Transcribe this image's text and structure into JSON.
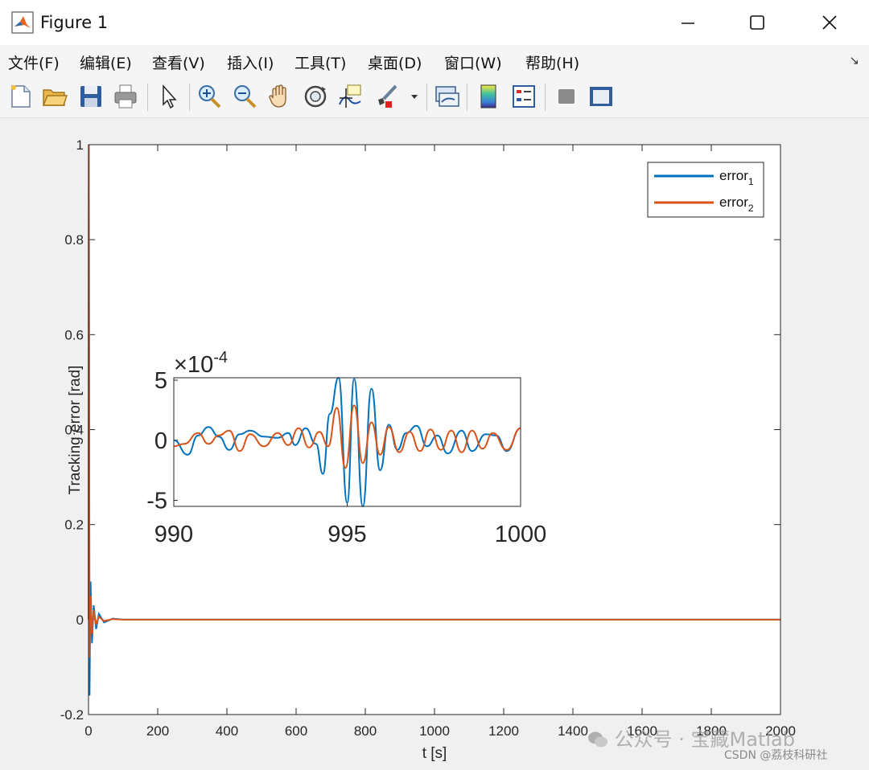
{
  "window": {
    "title": "Figure 1",
    "minimize_glyph": "—",
    "icons": [
      "matlab-logo-icon",
      "minimize-icon",
      "maximize-icon",
      "close-icon"
    ]
  },
  "menu": {
    "items": [
      "文件(F)",
      "编辑(E)",
      "查看(V)",
      "插入(I)",
      "工具(T)",
      "桌面(D)",
      "窗口(W)",
      "帮助(H)"
    ],
    "overflow_glyph": "↘"
  },
  "toolbar": {
    "icons": [
      "new-figure-icon",
      "open-file-icon",
      "save-icon",
      "print-icon",
      "select-arrow-icon",
      "zoom-in-icon",
      "zoom-out-icon",
      "pan-hand-icon",
      "rotate-3d-icon",
      "data-cursor-icon",
      "brush-icon",
      "link-plot-icon",
      "colorbar-icon",
      "legend-icon",
      "hide-plot-tools-icon",
      "show-plot-tools-icon"
    ]
  },
  "colors": {
    "error1": "#0072bd",
    "error2": "#d95319",
    "axes_bg": "#ffffff",
    "figure_bg": "#f0f0f0"
  },
  "chart_data": [
    {
      "type": "line",
      "xlabel": "t [s]",
      "ylabel": "Tracking error [rad]",
      "xlim": [
        0,
        2000
      ],
      "ylim": [
        -0.2,
        1
      ],
      "xticks": [
        "0",
        "200",
        "400",
        "600",
        "800",
        "1000",
        "1200",
        "1400",
        "1600",
        "1800",
        "2000"
      ],
      "yticks": [
        "-0.2",
        "0",
        "0.2",
        "0.4",
        "0.6",
        "0.8",
        "1"
      ],
      "legend": {
        "position": "top-right",
        "entries": [
          {
            "name": "error",
            "sub": "1"
          },
          {
            "name": "error",
            "sub": "2"
          }
        ]
      },
      "series": [
        {
          "name": "error1",
          "points": [
            [
              0,
              0
            ],
            [
              1,
              1
            ],
            [
              3,
              -0.16
            ],
            [
              6,
              0.08
            ],
            [
              10,
              -0.05
            ],
            [
              15,
              0.03
            ],
            [
              22,
              -0.02
            ],
            [
              30,
              0.012
            ],
            [
              45,
              -0.006
            ],
            [
              70,
              0.002
            ],
            [
              100,
              0
            ],
            [
              2000,
              0
            ]
          ]
        },
        {
          "name": "error2",
          "points": [
            [
              0,
              0
            ],
            [
              1,
              1
            ],
            [
              3,
              -0.08
            ],
            [
              6,
              0.05
            ],
            [
              10,
              -0.03
            ],
            [
              15,
              0.02
            ],
            [
              22,
              -0.01
            ],
            [
              30,
              0.006
            ],
            [
              45,
              -0.003
            ],
            [
              70,
              0.001
            ],
            [
              100,
              0
            ],
            [
              2000,
              0
            ]
          ]
        }
      ]
    },
    {
      "type": "line",
      "inset": true,
      "xlim": [
        990,
        1000
      ],
      "ylim": [
        -5.5,
        5.2
      ],
      "exponent_label": "×10",
      "exponent": "-4",
      "xticks": [
        "990",
        "995",
        "1000"
      ],
      "yticks": [
        "5",
        "0",
        "-5"
      ],
      "series": [
        {
          "name": "error1",
          "points": [
            [
              990,
              0
            ],
            [
              990.4,
              -1.2
            ],
            [
              990.7,
              0.4
            ],
            [
              991.0,
              1.1
            ],
            [
              991.3,
              0.3
            ],
            [
              991.6,
              -0.8
            ],
            [
              991.9,
              0.5
            ],
            [
              992.2,
              0.8
            ],
            [
              992.6,
              0.3
            ],
            [
              993.0,
              0.2
            ],
            [
              993.3,
              0.6
            ],
            [
              993.5,
              -0.4
            ],
            [
              993.8,
              1.0
            ],
            [
              994.1,
              -0.3
            ],
            [
              994.3,
              -2.8
            ],
            [
              994.5,
              2.2
            ],
            [
              994.75,
              5.2
            ],
            [
              995.0,
              -5.2
            ],
            [
              995.2,
              5.1
            ],
            [
              995.45,
              -5.5
            ],
            [
              995.7,
              4.3
            ],
            [
              995.95,
              -2.5
            ],
            [
              996.2,
              1.3
            ],
            [
              996.45,
              -0.8
            ],
            [
              996.7,
              0.6
            ],
            [
              997.0,
              1.2
            ],
            [
              997.3,
              -0.5
            ],
            [
              997.6,
              0.4
            ],
            [
              997.9,
              -1.1
            ],
            [
              998.3,
              0.8
            ],
            [
              998.6,
              -0.9
            ],
            [
              999.0,
              0.5
            ],
            [
              999.3,
              0.4
            ],
            [
              999.6,
              -0.9
            ],
            [
              1000.0,
              1.0
            ]
          ]
        },
        {
          "name": "error2",
          "points": [
            [
              990,
              -0.5
            ],
            [
              990.3,
              -0.3
            ],
            [
              990.7,
              0.6
            ],
            [
              991.0,
              -0.3
            ],
            [
              991.3,
              0.4
            ],
            [
              991.6,
              0.8
            ],
            [
              991.9,
              -0.9
            ],
            [
              992.2,
              0.5
            ],
            [
              992.6,
              -0.5
            ],
            [
              993.0,
              0.6
            ],
            [
              993.3,
              -0.4
            ],
            [
              993.6,
              1.0
            ],
            [
              993.9,
              -0.6
            ],
            [
              994.2,
              0.7
            ],
            [
              994.45,
              -0.5
            ],
            [
              994.7,
              2.7
            ],
            [
              994.95,
              -2.3
            ],
            [
              995.2,
              2.9
            ],
            [
              995.45,
              -1.9
            ],
            [
              995.7,
              1.5
            ],
            [
              995.95,
              -1.2
            ],
            [
              996.2,
              1.1
            ],
            [
              996.5,
              -1.0
            ],
            [
              996.8,
              0.7
            ],
            [
              997.1,
              -0.9
            ],
            [
              997.4,
              0.9
            ],
            [
              997.7,
              -0.8
            ],
            [
              998.0,
              0.8
            ],
            [
              998.3,
              -1.0
            ],
            [
              998.6,
              0.8
            ],
            [
              998.9,
              -0.7
            ],
            [
              999.2,
              0.6
            ],
            [
              999.6,
              -0.8
            ],
            [
              1000.0,
              1.0
            ]
          ]
        }
      ]
    }
  ],
  "watermark": {
    "text": "公众号 · 宝藏Matlab",
    "csdn": "CSDN @荔枝科研社"
  }
}
